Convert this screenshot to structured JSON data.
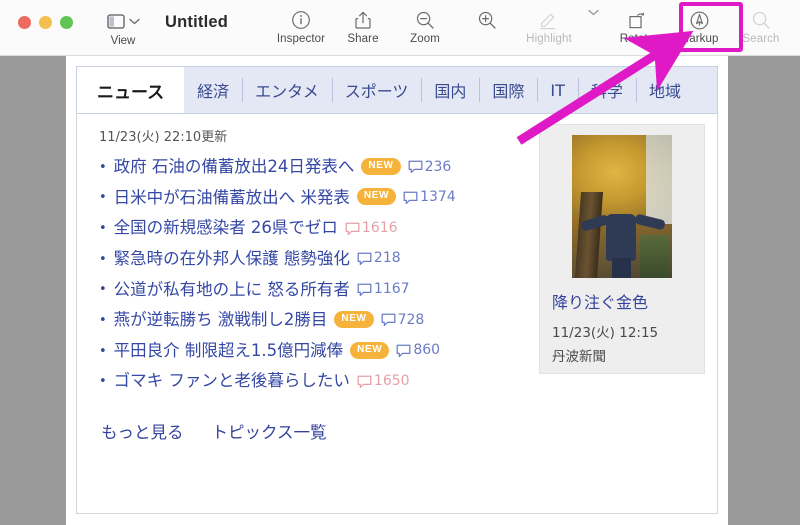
{
  "window": {
    "title": "Untitled",
    "traffic_lights": [
      "close",
      "minimize",
      "zoom"
    ]
  },
  "toolbar": {
    "view_label": "View",
    "items": [
      {
        "label": "Inspector",
        "icon": "info-circle-icon",
        "disabled": false
      },
      {
        "label": "Share",
        "icon": "share-icon",
        "disabled": false
      },
      {
        "label": "Zoom",
        "icon": "zoom-out-icon",
        "disabled": false
      },
      {
        "label": "",
        "icon": "zoom-in-icon",
        "disabled": false
      },
      {
        "label": "Highlight",
        "icon": "highlight-pen-icon",
        "disabled": true
      },
      {
        "label": "Rotate",
        "icon": "rotate-icon",
        "disabled": false
      },
      {
        "label": "Markup",
        "icon": "markup-pen-circle-icon",
        "disabled": false
      },
      {
        "label": "Search",
        "icon": "search-icon",
        "disabled": true
      }
    ],
    "zoom_label": "Zoom",
    "inspector_label": "Inspector",
    "share_label": "Share",
    "highlight_label": "Highlight",
    "rotate_label": "Rotate",
    "markup_label": "Markup",
    "search_label": "Search",
    "highlight_color": "#e019c6"
  },
  "content": {
    "tabs": [
      {
        "label": "ニュース",
        "active": true
      },
      {
        "label": "経済",
        "active": false
      },
      {
        "label": "エンタメ",
        "active": false
      },
      {
        "label": "スポーツ",
        "active": false
      },
      {
        "label": "国内",
        "active": false
      },
      {
        "label": "国際",
        "active": false
      },
      {
        "label": "IT",
        "active": false
      },
      {
        "label": "科学",
        "active": false
      },
      {
        "label": "地域",
        "active": false
      }
    ],
    "updated": "11/23(火) 22:10更新",
    "news": [
      {
        "headline": "政府 石油の備蓄放出24日発表へ",
        "new": true,
        "comments": "236",
        "hot": false
      },
      {
        "headline": "日米中が石油備蓄放出へ 米発表",
        "new": true,
        "comments": "1374",
        "hot": false
      },
      {
        "headline": "全国の新規感染者 26県でゼロ",
        "new": false,
        "comments": "1616",
        "hot": true
      },
      {
        "headline": "緊急時の在外邦人保護 態勢強化",
        "new": false,
        "comments": "218",
        "hot": false
      },
      {
        "headline": "公道が私有地の上に 怒る所有者",
        "new": false,
        "comments": "1167",
        "hot": false
      },
      {
        "headline": "燕が逆転勝ち 激戦制し2勝目",
        "new": true,
        "comments": "728",
        "hot": false
      },
      {
        "headline": "平田良介 制限超え1.5億円減俸",
        "new": true,
        "comments": "860",
        "hot": false
      },
      {
        "headline": "ゴマキ ファンと老後暮らしたい",
        "new": false,
        "comments": "1650",
        "hot": true
      }
    ],
    "new_badge_label": "NEW",
    "more_links": [
      "もっと見る",
      "トピックス一覧"
    ],
    "card": {
      "title": "降り注ぐ金色",
      "date": "11/23(火) 12:15",
      "source": "丹波新聞",
      "image_alt": "秋の銀杏の木と人物"
    }
  },
  "colors": {
    "link_blue": "#35439b",
    "tab_bg": "#e3e8f4",
    "badge_orange": "#f6b33c",
    "comment_blue": "#6b7cc4",
    "comment_hot": "#e4a0a6",
    "annotation_magenta": "#e019c6",
    "window_gray": "#9a9a9a"
  }
}
